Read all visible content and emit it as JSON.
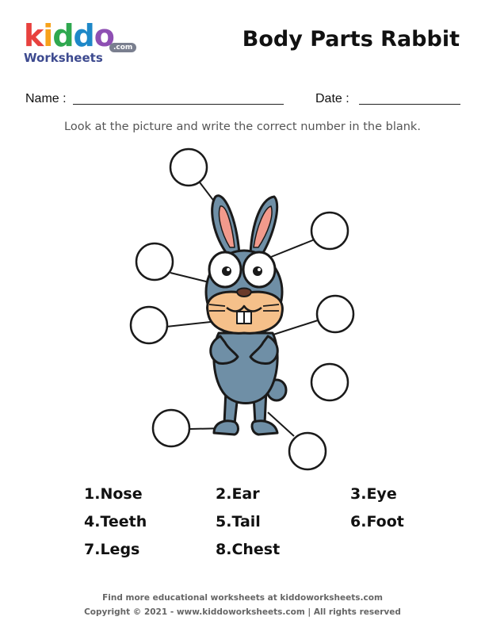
{
  "logo": {
    "kiddo_letters": [
      "k",
      "i",
      "d",
      "d",
      "o"
    ],
    "kiddo_colors": [
      "#e8413e",
      "#f7a21b",
      "#2fa84f",
      "#1e88c8",
      "#8e4fb3"
    ],
    "worksheets": "Worksheets",
    "com": ".com"
  },
  "title": "Body Parts Rabbit",
  "fields": {
    "name_label": "Name :",
    "date_label": "Date :"
  },
  "instruction": "Look at the picture and write the correct number in the blank.",
  "rabbit_colors": {
    "body": "#6f8fa6",
    "outline": "#1a1a1a",
    "inner_ear": "#f29a8c",
    "muzzle": "#f5c08a"
  },
  "word_bank": [
    {
      "number": "1.",
      "word": "Nose"
    },
    {
      "number": "2.",
      "word": "Ear"
    },
    {
      "number": "3.",
      "word": "Eye"
    },
    {
      "number": "4.",
      "word": "Teeth"
    },
    {
      "number": "5.",
      "word": "Tail"
    },
    {
      "number": "6.",
      "word": "Foot"
    },
    {
      "number": "7.",
      "word": "Legs"
    },
    {
      "number": "8.",
      "word": "Chest"
    }
  ],
  "footer": {
    "line1": "Find more educational worksheets at kiddoworksheets.com",
    "line2": "Copyright © 2021 - www.kiddoworksheets.com  |  All rights reserved"
  }
}
